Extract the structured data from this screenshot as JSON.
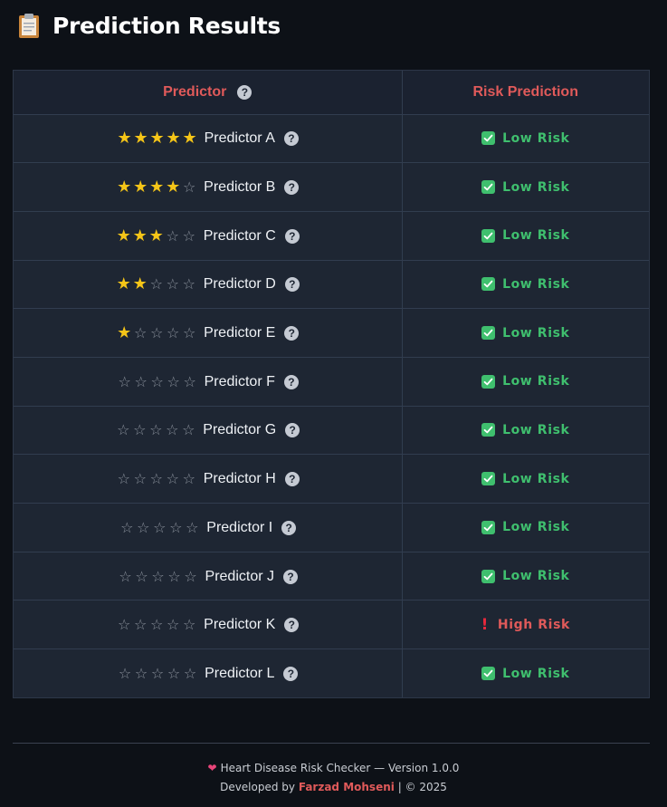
{
  "page": {
    "title": "Prediction Results",
    "icon": "clipboard-icon"
  },
  "table": {
    "headers": {
      "predictor": "Predictor",
      "risk": "Risk Prediction"
    },
    "rows": [
      {
        "name": "Predictor A",
        "rating": 5,
        "risk": "Low Risk",
        "risk_level": "low"
      },
      {
        "name": "Predictor B",
        "rating": 4,
        "risk": "Low Risk",
        "risk_level": "low"
      },
      {
        "name": "Predictor C",
        "rating": 3,
        "risk": "Low Risk",
        "risk_level": "low"
      },
      {
        "name": "Predictor D",
        "rating": 2,
        "risk": "Low Risk",
        "risk_level": "low"
      },
      {
        "name": "Predictor E",
        "rating": 1,
        "risk": "Low Risk",
        "risk_level": "low"
      },
      {
        "name": "Predictor F",
        "rating": 0,
        "risk": "Low Risk",
        "risk_level": "low"
      },
      {
        "name": "Predictor G",
        "rating": 0,
        "risk": "Low Risk",
        "risk_level": "low"
      },
      {
        "name": "Predictor H",
        "rating": 0,
        "risk": "Low Risk",
        "risk_level": "low"
      },
      {
        "name": "Predictor I",
        "rating": 0,
        "risk": "Low Risk",
        "risk_level": "low"
      },
      {
        "name": "Predictor J",
        "rating": 0,
        "risk": "Low Risk",
        "risk_level": "low"
      },
      {
        "name": "Predictor K",
        "rating": 0,
        "risk": "High Risk",
        "risk_level": "high"
      },
      {
        "name": "Predictor L",
        "rating": 0,
        "risk": "Low Risk",
        "risk_level": "low"
      }
    ],
    "max_rating": 5
  },
  "footer": {
    "line1": "Heart Disease Risk Checker — Version 1.0.0",
    "developed_by": "Developed by",
    "author": "Farzad Mohseni",
    "copyright": "| © 2025"
  },
  "colors": {
    "accent": "#e05a5a",
    "low_risk": "#3fbf6e",
    "high_risk": "#e8283c",
    "star_filled": "#f5c518",
    "background": "#0d1117"
  }
}
